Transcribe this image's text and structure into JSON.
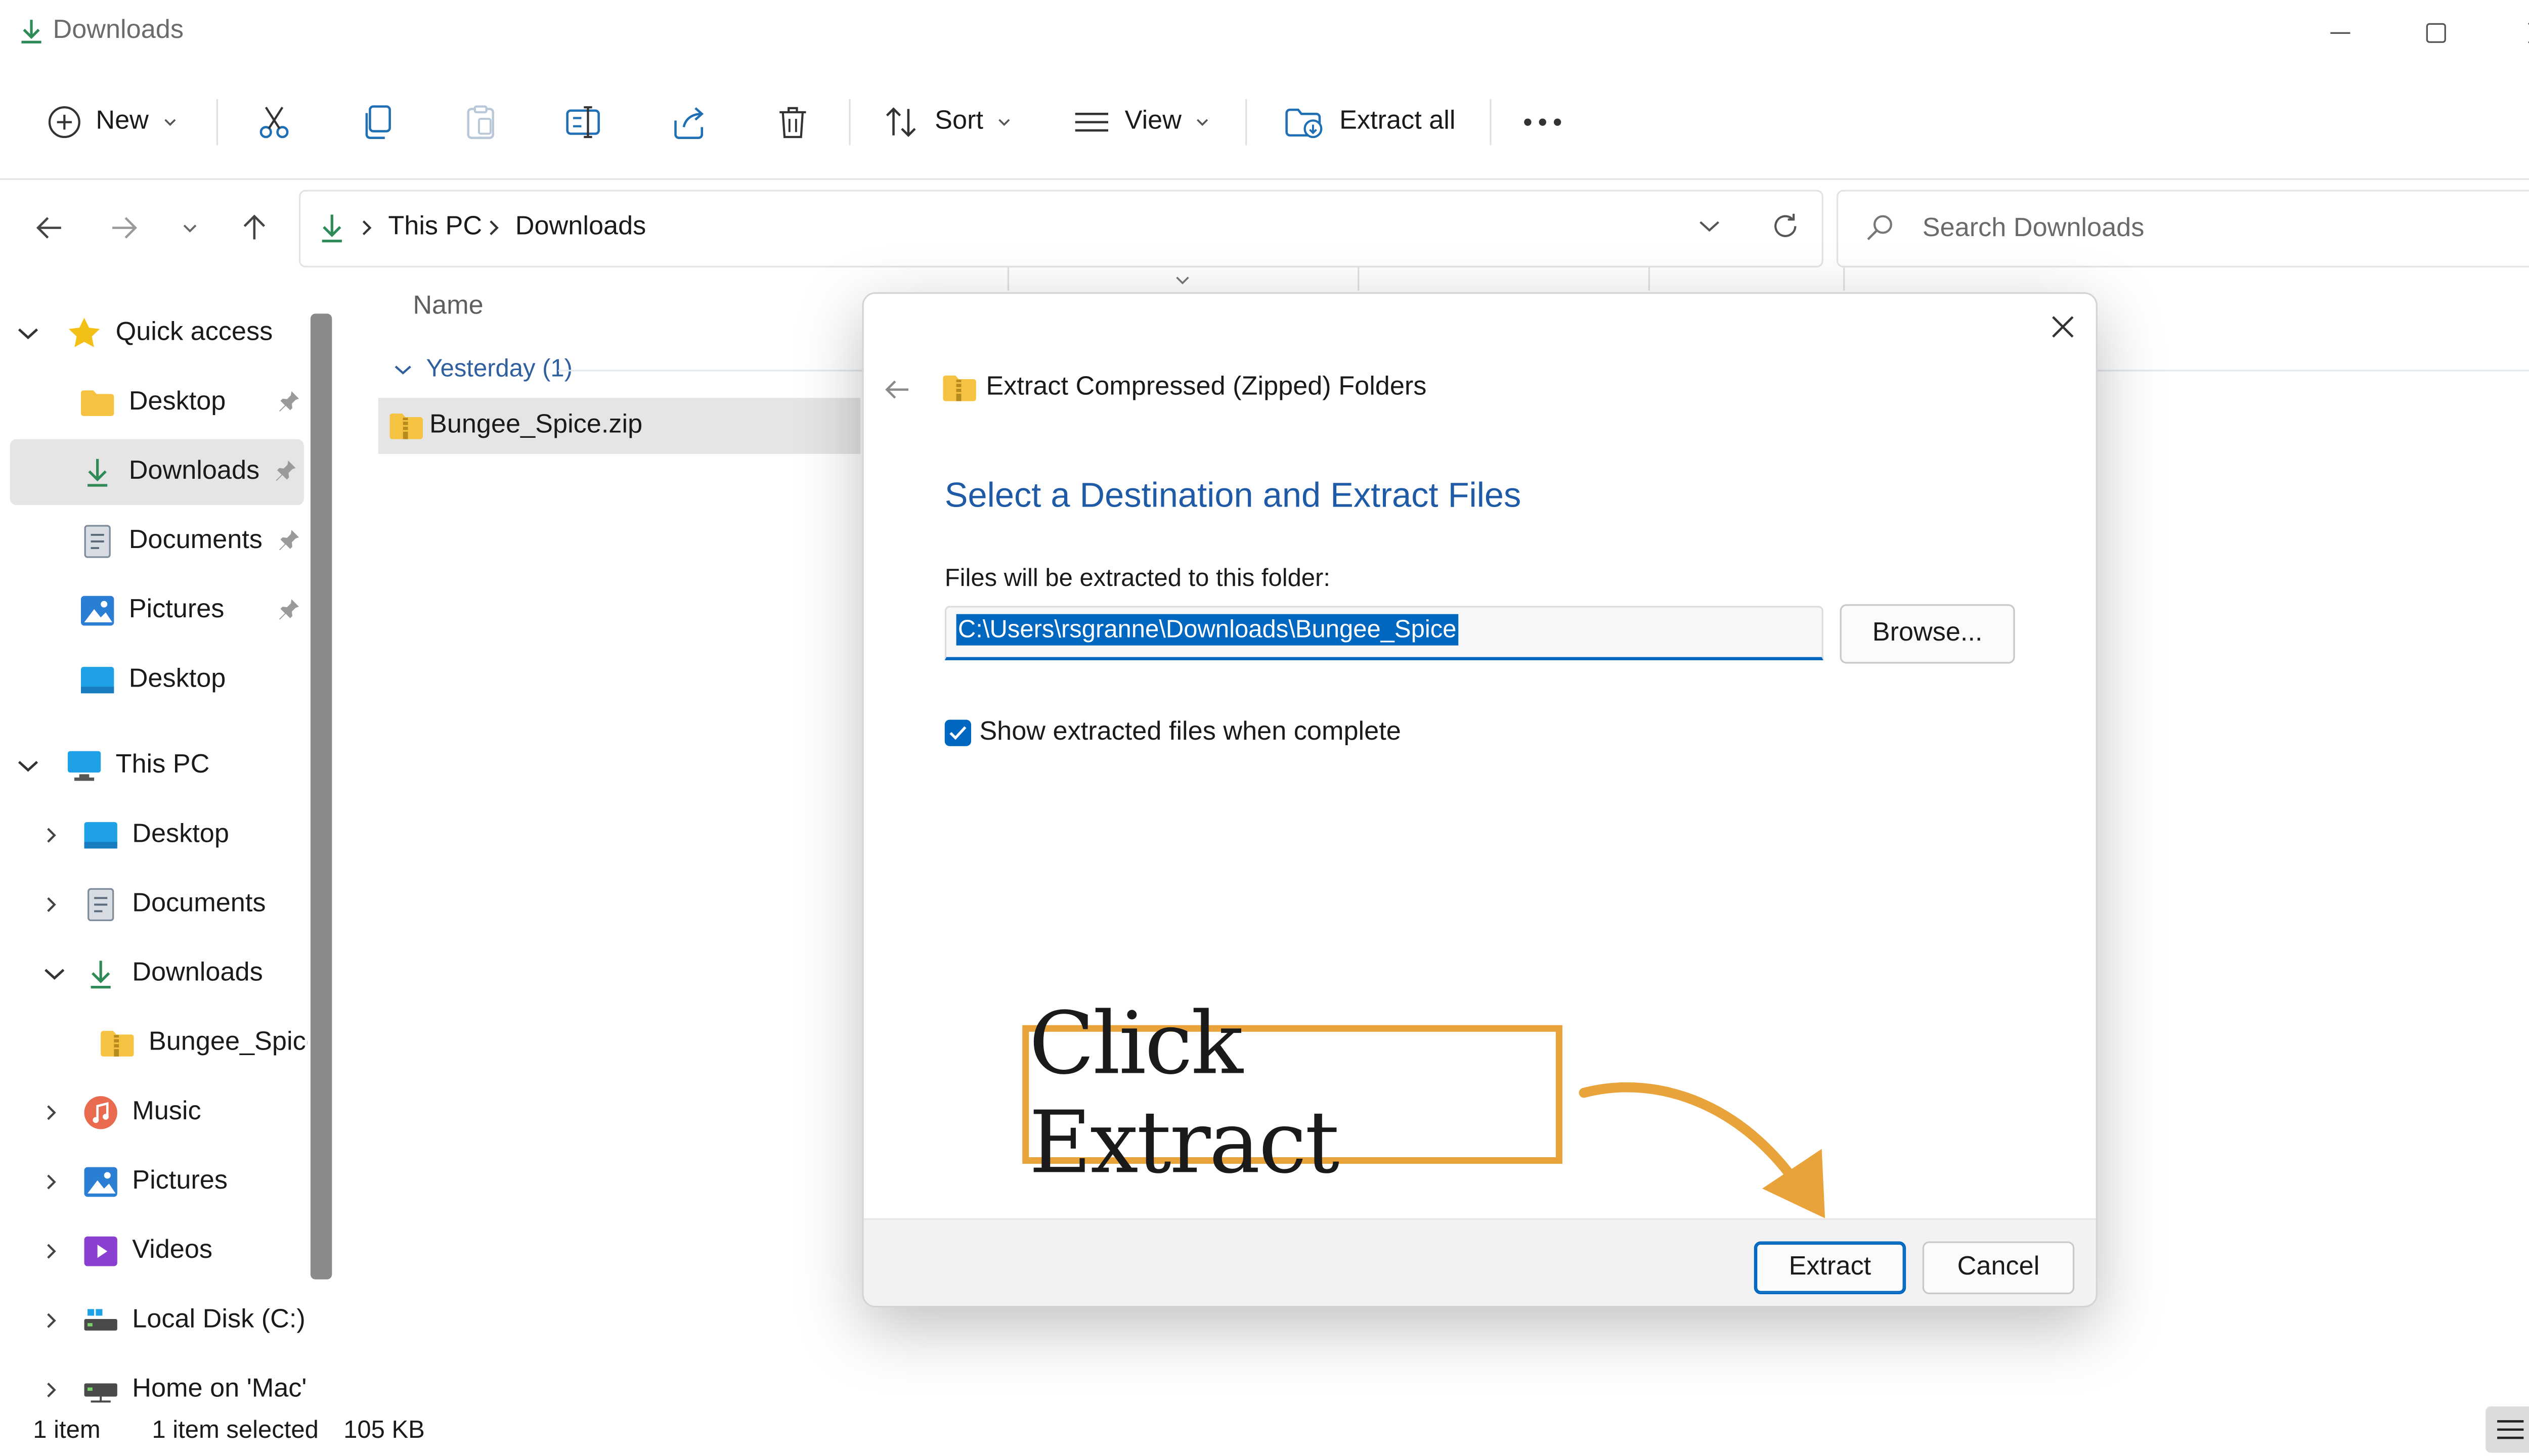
{
  "window": {
    "title": "Downloads"
  },
  "toolbar": {
    "new_label": "New",
    "sort_label": "Sort",
    "view_label": "View",
    "extract_all_label": "Extract all"
  },
  "address": {
    "crumbs": [
      "This PC",
      "Downloads"
    ],
    "search_placeholder": "Search Downloads"
  },
  "sidebar": {
    "quick_access": "Quick access",
    "quick_items": [
      {
        "label": "Desktop",
        "icon": "folder-yellow-icon",
        "pinned": true
      },
      {
        "label": "Downloads",
        "icon": "download-arrow-icon",
        "pinned": true,
        "selected": true
      },
      {
        "label": "Documents",
        "icon": "document-icon",
        "pinned": true
      },
      {
        "label": "Pictures",
        "icon": "pictures-icon",
        "pinned": true
      },
      {
        "label": "Desktop",
        "icon": "desktop-blue-icon",
        "pinned": false
      }
    ],
    "this_pc": "This PC",
    "pc_items": [
      {
        "label": "Desktop",
        "icon": "desktop-blue-icon"
      },
      {
        "label": "Documents",
        "icon": "document-icon"
      },
      {
        "label": "Downloads",
        "icon": "download-arrow-icon",
        "expanded": true
      },
      {
        "label": "Bungee_Spice",
        "icon": "zip-folder-icon",
        "child": true
      },
      {
        "label": "Music",
        "icon": "music-icon"
      },
      {
        "label": "Pictures",
        "icon": "pictures-icon"
      },
      {
        "label": "Videos",
        "icon": "videos-icon"
      },
      {
        "label": "Local Disk (C:)",
        "icon": "drive-icon"
      },
      {
        "label": "Home on 'Mac'",
        "icon": "network-drive-icon"
      }
    ]
  },
  "filelist": {
    "column_name": "Name",
    "group": "Yesterday (1)",
    "files": [
      {
        "name": "Bungee_Spice.zip",
        "icon": "zip-folder-icon"
      }
    ]
  },
  "status": {
    "count": "1 item",
    "selected": "1 item selected",
    "size": "105 KB"
  },
  "dialog": {
    "header": "Extract Compressed (Zipped) Folders",
    "heading": "Select a Destination and Extract Files",
    "path_label": "Files will be extracted to this folder:",
    "path_value": "C:\\Users\\rsgranne\\Downloads\\Bungee_Spice",
    "browse_label": "Browse...",
    "checkbox_label": "Show extracted files when complete",
    "checkbox_checked": true,
    "extract_label": "Extract",
    "cancel_label": "Cancel"
  },
  "annotation": {
    "text": "Click Extract",
    "color": "#e8a33a"
  },
  "colors": {
    "accent": "#0067c0",
    "heading": "#1f5aa6",
    "folder": "#f5c242",
    "annotation": "#e8a33a"
  }
}
